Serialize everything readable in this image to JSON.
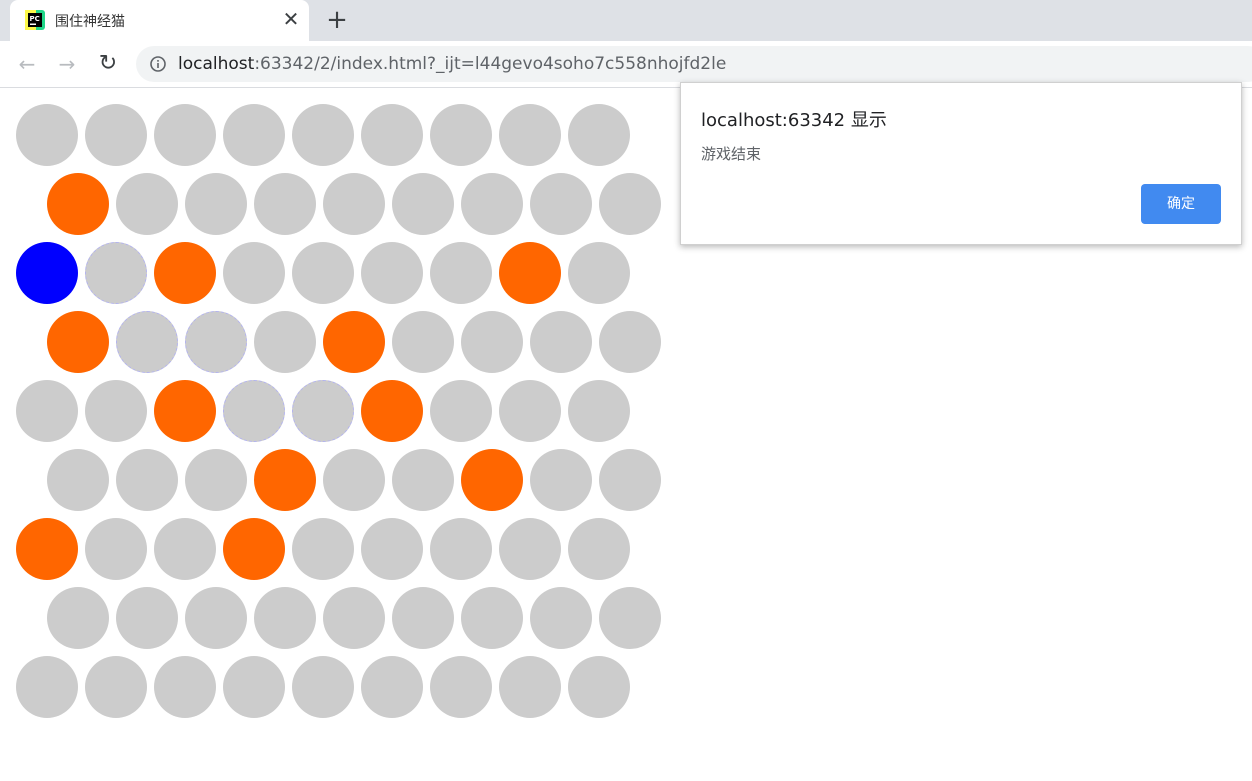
{
  "browser": {
    "tab_title": "围住神经猫",
    "favicon_label": "PC",
    "url_host": "localhost",
    "url_rest": ":63342/2/index.html?_ijt=l44gevo4soho7c558nhojfd2le",
    "back_icon": "←",
    "forward_icon": "→",
    "reload_icon": "↻",
    "close_tab_icon": "✕",
    "new_tab_icon": "+"
  },
  "dialog": {
    "title": "localhost:63342 显示",
    "message": "游戏结束",
    "ok_label": "确定"
  },
  "game": {
    "colors": {
      "empty": "#cccccc",
      "wall": "#ff6600",
      "cat": "#0000ff",
      "path_border": "#b3b3ee"
    },
    "legend": "0 = empty, 1 = wall, 2 = cat, 3 = empty with path outline",
    "grid": [
      [
        0,
        0,
        0,
        0,
        0,
        0,
        0,
        0,
        0
      ],
      [
        1,
        0,
        0,
        0,
        0,
        0,
        0,
        0,
        0
      ],
      [
        2,
        3,
        1,
        0,
        0,
        0,
        0,
        1,
        0
      ],
      [
        1,
        3,
        3,
        0,
        1,
        0,
        0,
        0,
        0
      ],
      [
        0,
        0,
        1,
        3,
        3,
        1,
        0,
        0,
        0
      ],
      [
        0,
        0,
        0,
        1,
        0,
        0,
        1,
        0,
        0
      ],
      [
        1,
        0,
        0,
        1,
        0,
        0,
        0,
        0,
        0
      ],
      [
        0,
        0,
        0,
        0,
        0,
        0,
        0,
        0,
        0
      ],
      [
        0,
        0,
        0,
        0,
        0,
        0,
        0,
        0,
        0
      ]
    ]
  }
}
